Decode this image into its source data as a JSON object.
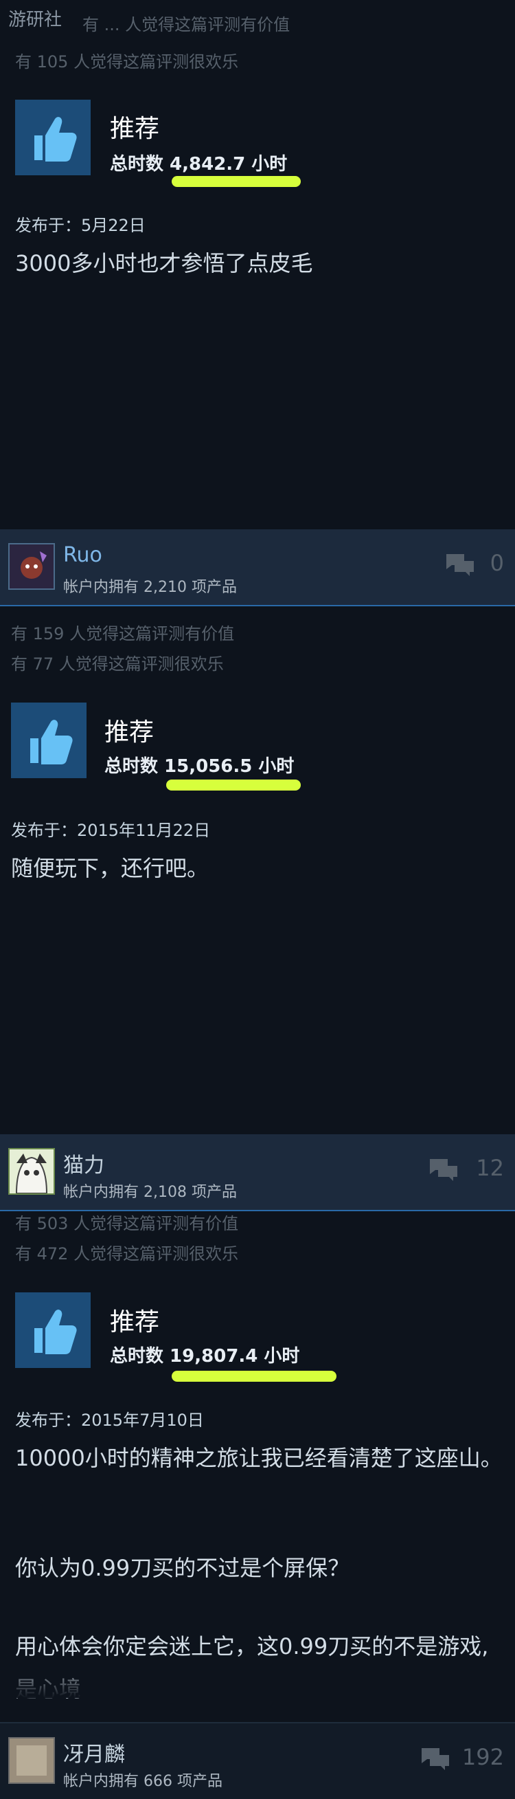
{
  "watermark": "游研社",
  "reviews": [
    {
      "helpful": "有 ... 人觉得这篇评测有价值",
      "funny": "有 105 人觉得这篇评测很欢乐",
      "recommend": "推荐",
      "hours": "总时数 4,842.7 小时",
      "posted": "发布于：5月22日",
      "body": "3000多小时也才参悟了点皮毛"
    },
    {
      "user": {
        "name": "Ruo",
        "owned": "帐户内拥有 2,210 项产品",
        "comments": "0"
      },
      "helpful": "有 159 人觉得这篇评测有价值",
      "funny": "有 77 人觉得这篇评测很欢乐",
      "recommend": "推荐",
      "hours": "总时数 15,056.5 小时",
      "posted": "发布于：2015年11月22日",
      "body": "随便玩下，还行吧。"
    },
    {
      "user": {
        "name": "猫力",
        "owned": "帐户内拥有 2,108 项产品",
        "comments": "12"
      },
      "helpful": "有 503 人觉得这篇评测有价值",
      "funny": "有 472 人觉得这篇评测很欢乐",
      "recommend": "推荐",
      "hours": "总时数 19,807.4 小时",
      "posted": "发布于：2015年7月10日",
      "body1": "10000小时的精神之旅让我已经看清楚了这座山。",
      "body2": "你认为0.99刀买的不过是个屏保？",
      "body3": "用心体会你定会迷上它，这0.99刀买的不是游戏,是心境"
    }
  ],
  "last_user": {
    "name": "冴月麟",
    "owned": "帐户内拥有 666 项产品",
    "comments": "192"
  },
  "colors": {
    "highlight": "#d7ff3c",
    "thumb_bg": "#1c4c78",
    "link": "#7fb7e8"
  }
}
